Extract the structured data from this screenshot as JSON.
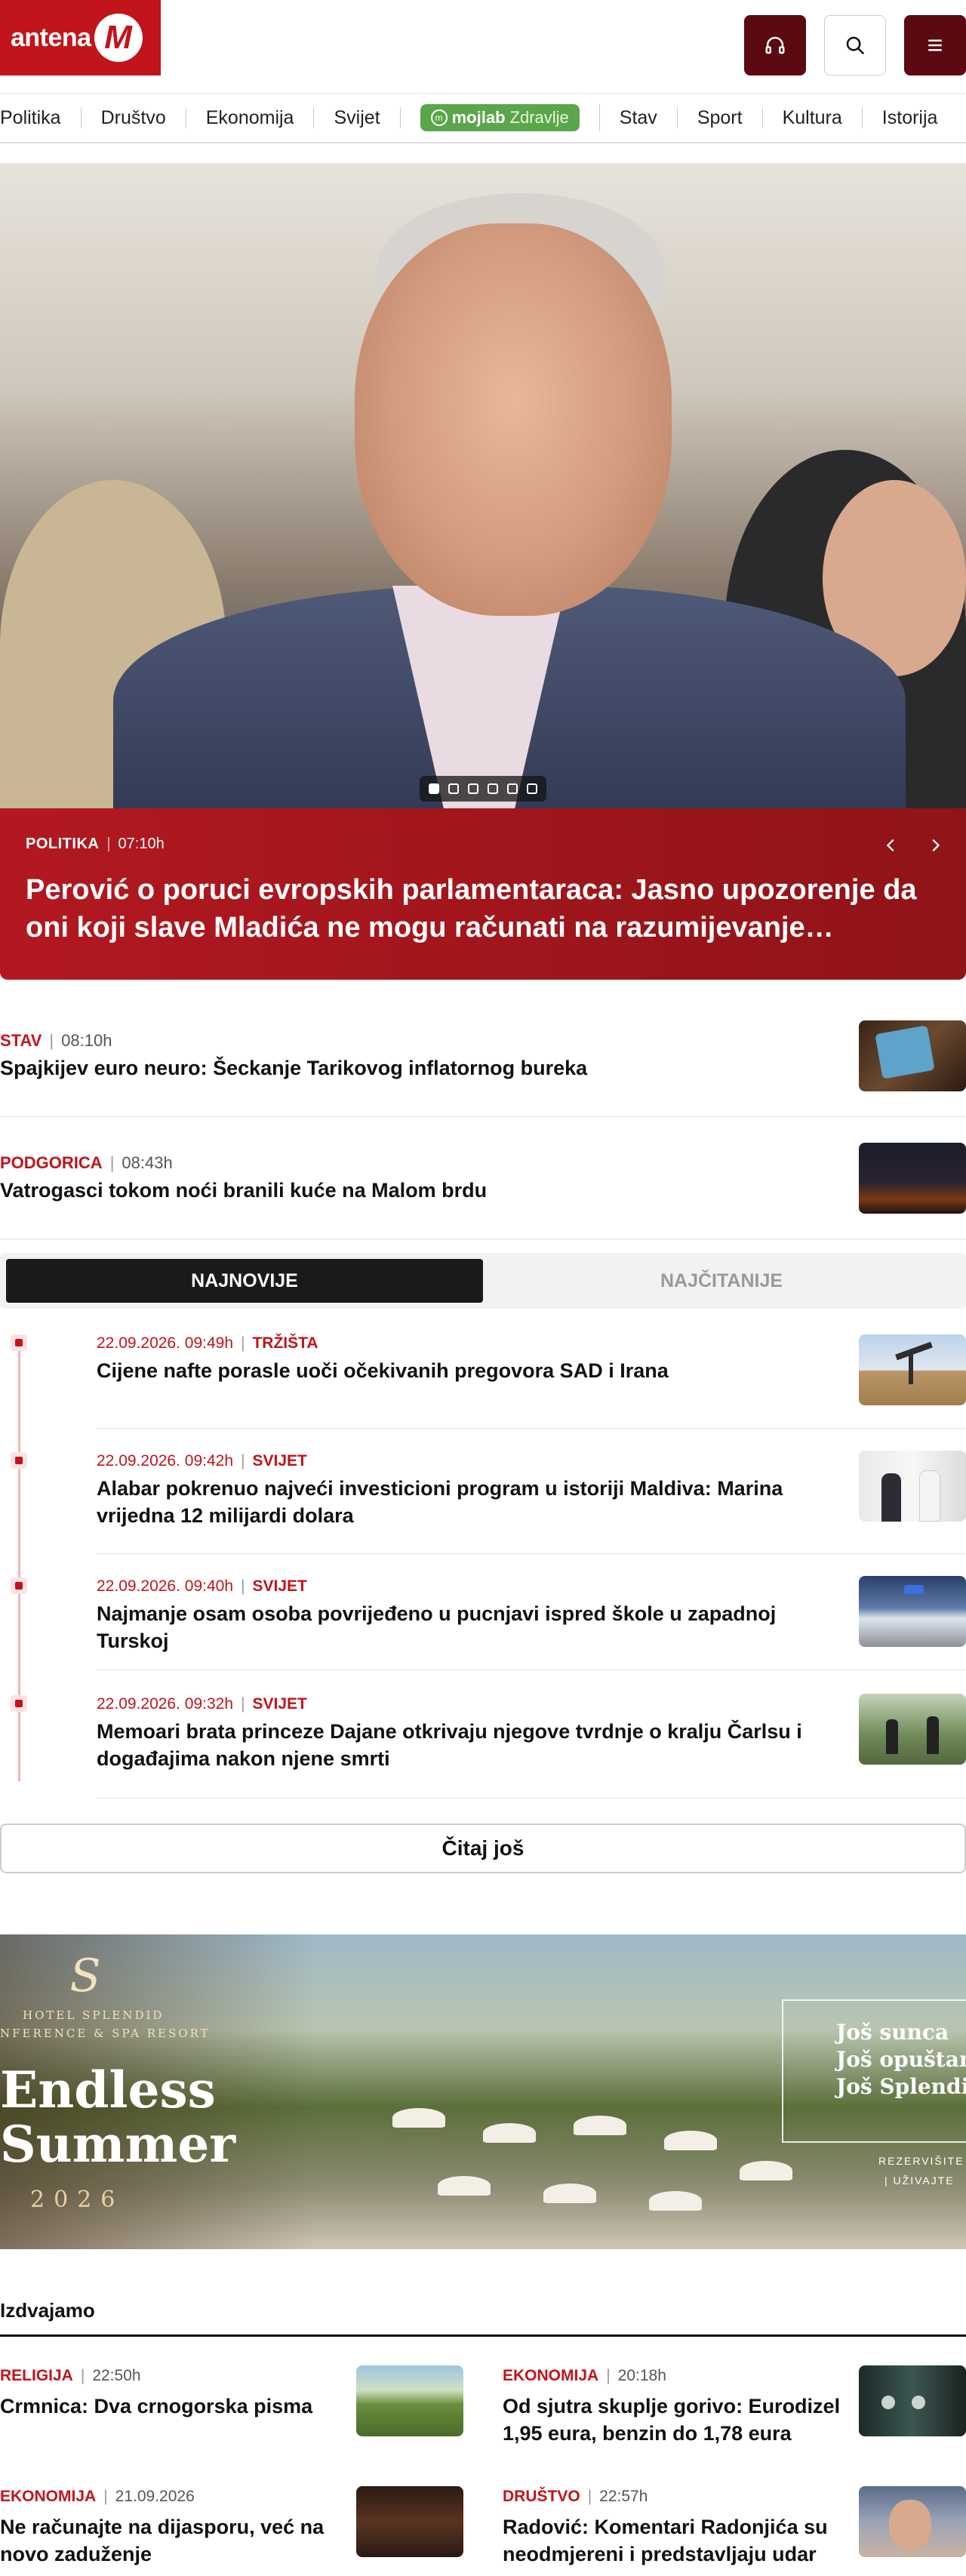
{
  "header": {
    "logo_text": "antena",
    "logo_mark": "M",
    "icons": {
      "audio": "headphones-icon",
      "search": "search-icon",
      "menu": "hamburger-menu-icon"
    },
    "colors": {
      "brand": "#c1141b",
      "dark_button": "#5a0a10"
    }
  },
  "nav": {
    "items": [
      "Politika",
      "Društvo",
      "Ekonomija",
      "Svijet"
    ],
    "pill": {
      "brand": "moj",
      "brand2": "lab",
      "sub": "Zdravlje"
    },
    "items_after": [
      "Stav",
      "Sport",
      "Kultura",
      "Istorija"
    ]
  },
  "hero": {
    "category": "POLITIKA",
    "time": "07:10h",
    "title": "Perović o poruci evropskih parlamentaraca: Jasno upozorenje da oni koji slave Mladića ne mogu računati na razumijevanje…",
    "slides_total": 6,
    "slide_active": 1
  },
  "small_news": [
    {
      "category": "STAV",
      "time": "08:10h",
      "title": "Spajkijev euro neuro: Šeckanje Tarikovog inflatornog bureka"
    },
    {
      "category": "PODGORICA",
      "time": "08:43h",
      "title": "Vatrogasci tokom noći branili kuće na Malom brdu"
    }
  ],
  "tabs": {
    "latest": "NAJNOVIJE",
    "most_read": "NAJČITANIJE"
  },
  "timeline": [
    {
      "date": "22.09.2026. 09:49h",
      "category": "TRŽIŠTA",
      "title": "Cijene nafte porasle uoči očekivanih pregovora SAD i Irana"
    },
    {
      "date": "22.09.2026. 09:42h",
      "category": "SVIJET",
      "title": "Alabar pokrenuo najveći investicioni program u istoriji Maldiva: Marina vrijedna 12 milijardi dolara"
    },
    {
      "date": "22.09.2026. 09:40h",
      "category": "SVIJET",
      "title": "Najmanje osam osoba povrijeđeno u pucnjavi ispred škole u zapadnoj Turskoj"
    },
    {
      "date": "22.09.2026. 09:32h",
      "category": "SVIJET",
      "title": "Memoari brata princeze Dajane otkrivaju njegove tvrdnje o kralju Čarlsu i događajima nakon njene smrti"
    }
  ],
  "read_more": "Čitaj još",
  "banner": {
    "logo": "S",
    "hotel": "HOTEL SPLENDID",
    "resort": "NFERENCE & SPA RESORT",
    "line1": "Endless",
    "line2": "Summer",
    "year": "2026",
    "box1": "Još sunca",
    "box2": "Još opuštan",
    "box3": "Još Splendi",
    "cta1": "REZERVIŠITE",
    "cta2": "| UŽIVAJTE"
  },
  "featured": {
    "heading": "Izdvajamo",
    "items": [
      {
        "category": "RELIGIJA",
        "time": "22:50h",
        "title": "Crmnica: Dva crnogorska pisma"
      },
      {
        "category": "EKONOMIJA",
        "time": "20:18h",
        "title": "Od sjutra skuplje gorivo: Eurodizel 1,95 eura, benzin do 1,78 eura"
      },
      {
        "category": "EKONOMIJA",
        "time": "21.09.2026",
        "title": "Ne računajte na dijasporu, već na novo zaduženje"
      },
      {
        "category": "DRUŠTVO",
        "time": "22:57h",
        "title": "Radović: Komentari Radonjića su neodmjereni i predstavljaju udar na"
      }
    ]
  }
}
